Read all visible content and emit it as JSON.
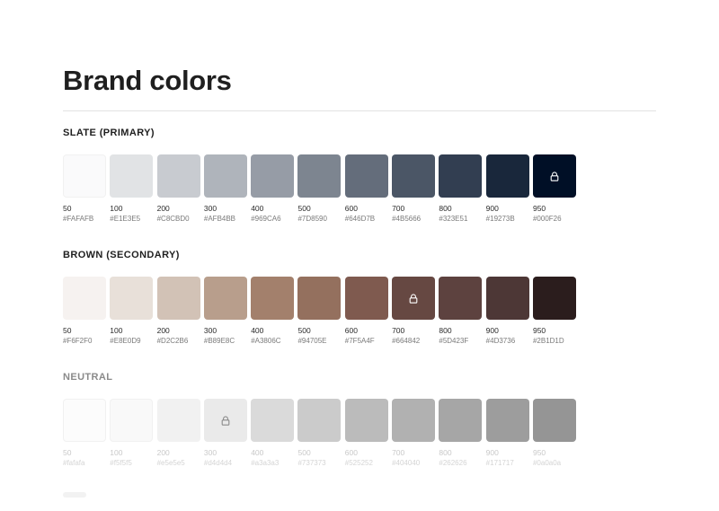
{
  "page": {
    "title": "Brand colors"
  },
  "palettes": [
    {
      "name": "SLATE (PRIMARY)",
      "id": "slate",
      "swatches": [
        {
          "shade": "50",
          "hex": "#FAFAFB",
          "color": "#FAFAFB",
          "locked": false
        },
        {
          "shade": "100",
          "hex": "#E1E3E5",
          "color": "#E1E3E5",
          "locked": false
        },
        {
          "shade": "200",
          "hex": "#C8CBD0",
          "color": "#C8CBD0",
          "locked": false
        },
        {
          "shade": "300",
          "hex": "#AFB4BB",
          "color": "#AFB4BB",
          "locked": false
        },
        {
          "shade": "400",
          "hex": "#969CA6",
          "color": "#969CA6",
          "locked": false
        },
        {
          "shade": "500",
          "hex": "#7D8590",
          "color": "#7D8590",
          "locked": false
        },
        {
          "shade": "600",
          "hex": "#646D7B",
          "color": "#646D7B",
          "locked": false
        },
        {
          "shade": "700",
          "hex": "#4B5666",
          "color": "#4B5666",
          "locked": false
        },
        {
          "shade": "800",
          "hex": "#323E51",
          "color": "#323E51",
          "locked": false
        },
        {
          "shade": "900",
          "hex": "#19273B",
          "color": "#19273B",
          "locked": false
        },
        {
          "shade": "950",
          "hex": "#000F26",
          "color": "#000F26",
          "locked": true
        }
      ]
    },
    {
      "name": "BROWN (SECONDARY)",
      "id": "brown",
      "swatches": [
        {
          "shade": "50",
          "hex": "#F6F2F0",
          "color": "#F6F2F0",
          "locked": false
        },
        {
          "shade": "100",
          "hex": "#E8E0D9",
          "color": "#E8E0D9",
          "locked": false
        },
        {
          "shade": "200",
          "hex": "#D2C2B6",
          "color": "#D2C2B6",
          "locked": false
        },
        {
          "shade": "300",
          "hex": "#B89E8C",
          "color": "#B89E8C",
          "locked": false
        },
        {
          "shade": "400",
          "hex": "#A3806C",
          "color": "#A3806C",
          "locked": false
        },
        {
          "shade": "500",
          "hex": "#94705E",
          "color": "#94705E",
          "locked": false
        },
        {
          "shade": "600",
          "hex": "#7F5A4F",
          "color": "#7F5A4F",
          "locked": false
        },
        {
          "shade": "700",
          "hex": "#664842",
          "color": "#664842",
          "locked": true
        },
        {
          "shade": "800",
          "hex": "#5D423F",
          "color": "#5D423F",
          "locked": false
        },
        {
          "shade": "900",
          "hex": "#4D3736",
          "color": "#4D3736",
          "locked": false
        },
        {
          "shade": "950",
          "hex": "#2B1D1D",
          "color": "#2B1D1D",
          "locked": false
        }
      ]
    },
    {
      "name": "NEUTRAL",
      "id": "neutral",
      "swatches": [
        {
          "shade": "50",
          "hex": "#fafafa",
          "color": "#FCFCFC",
          "locked": false
        },
        {
          "shade": "100",
          "hex": "#f5f5f5",
          "color": "#F9F9F9",
          "locked": false
        },
        {
          "shade": "200",
          "hex": "#e5e5e5",
          "color": "#F1F1F1",
          "locked": false
        },
        {
          "shade": "300",
          "hex": "#d4d4d4",
          "color": "#EAEAEA",
          "locked": true
        },
        {
          "shade": "400",
          "hex": "#a3a3a3",
          "color": "#DADADA",
          "locked": false
        },
        {
          "shade": "500",
          "hex": "#737373",
          "color": "#CBCBCB",
          "locked": false
        },
        {
          "shade": "600",
          "hex": "#525252",
          "color": "#BBBBBB",
          "locked": false
        },
        {
          "shade": "700",
          "hex": "#404040",
          "color": "#B1B1B1",
          "locked": false
        },
        {
          "shade": "800",
          "hex": "#262626",
          "color": "#A6A6A6",
          "locked": false
        },
        {
          "shade": "900",
          "hex": "#171717",
          "color": "#9D9D9D",
          "locked": false
        },
        {
          "shade": "950",
          "hex": "#0a0a0a",
          "color": "#959595",
          "locked": false
        }
      ]
    }
  ],
  "colors": {
    "title_text": "#1F1F1F",
    "divider": "#E2E2E2",
    "lock_on_dark": "#FFFFFF",
    "lock_on_light": "#8A8A8A"
  },
  "icons": {
    "lock": "lock-icon"
  }
}
